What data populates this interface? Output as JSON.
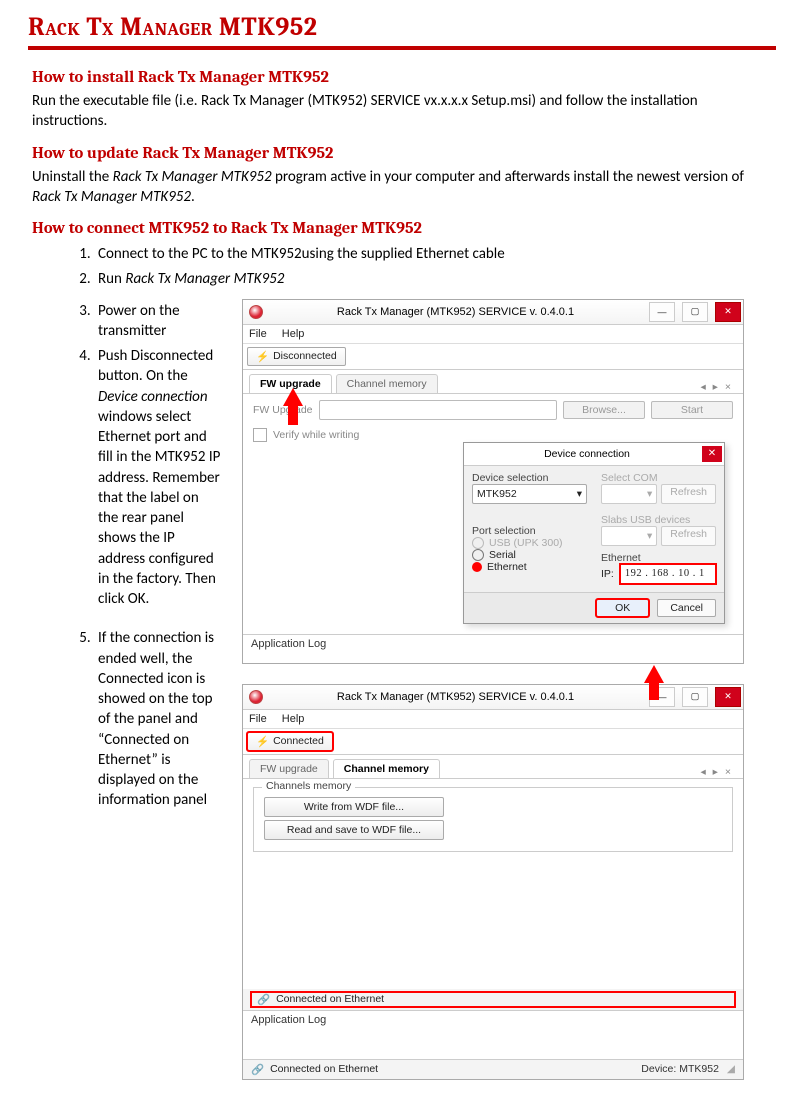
{
  "title": "Rack Tx Manager MTK952",
  "sec_install": {
    "h": "How to install Rack Tx Manager MTK952",
    "p": "Run the executable file (i.e. Rack Tx Manager (MTK952) SERVICE vx.x.x.x Setup.msi) and follow the installation instructions."
  },
  "sec_update": {
    "h": "How to update Rack Tx Manager MTK952",
    "p_pre": "Uninstall the ",
    "p_em1": "Rack Tx Manager MTK952",
    "p_mid": " program active in your computer and afterwards install the newest version of ",
    "p_em2": "Rack Tx Manager MTK952",
    "p_suf": "."
  },
  "sec_connect": {
    "h": "How to connect MTK952 to Rack Tx Manager MTK952",
    "steps12": [
      "Connect to the PC to the MTK952using the supplied Ethernet cable",
      "Run Rack Tx Manager MTK952"
    ],
    "step2_em": "Rack Tx Manager MTK952",
    "step2_pre": "Run ",
    "step3": "Power on the transmitter",
    "step4_pre": "Push Disconnected button. On the ",
    "step4_em": "Device connection",
    "step4_suf": " windows select Ethernet port and fill in the MTK952 IP address. Remember that the label on the rear panel shows the IP address configured in the factory. Then click OK.",
    "step5": "If the connection is ended well, the Connected icon is showed on the top of the panel and “Connected on Ethernet” is displayed on the information panel"
  },
  "app": {
    "title": "Rack Tx Manager (MTK952) SERVICE v. 0.4.0.1",
    "menu_file": "File",
    "menu_help": "Help",
    "btn_disconnected": "Disconnected",
    "btn_connected": "Connected",
    "tab_fw": "FW upgrade",
    "tab_ch": "Channel memory",
    "tab_arrows": "◂ ▸ ×",
    "label_fw": "FW Upgrade",
    "btn_browse": "Browse...",
    "btn_start": "Start",
    "chk_verify": "Verify while writing",
    "dialog": {
      "title": "Device connection",
      "dev_sel_label": "Device selection",
      "dev_sel_value": "MTK952",
      "com_label": "Select COM",
      "refresh": "Refresh",
      "port_label": "Port selection",
      "usb_label": "Slabs USB devices",
      "radio_usb": "USB (UPK 300)",
      "radio_serial": "Serial",
      "radio_eth": "Ethernet",
      "eth_label": "Ethernet",
      "ip_label": "IP:",
      "ip_value": "192 . 168 .  10 .   1",
      "ok": "OK",
      "cancel": "Cancel"
    },
    "log_title": "Application Log",
    "channels_legend": "Channels memory",
    "btn_write": "Write from WDF file...",
    "btn_read": "Read and save to WDF file...",
    "status_connected": "Connected on Ethernet",
    "status_device": "Device: MTK952"
  }
}
